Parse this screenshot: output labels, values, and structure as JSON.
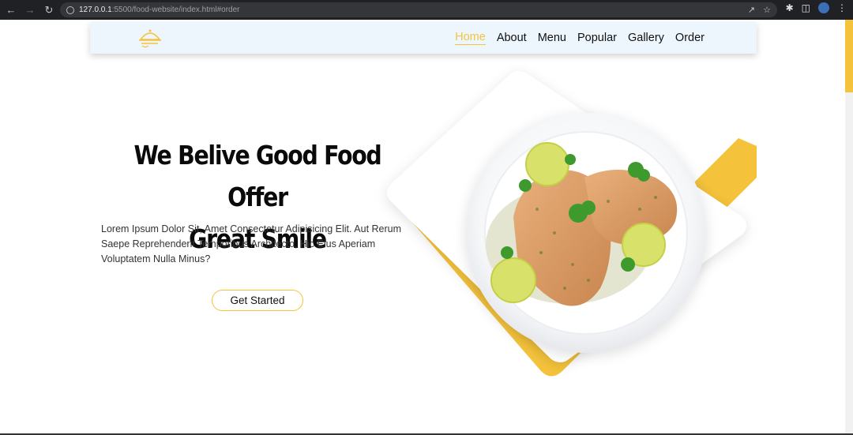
{
  "browser": {
    "url_host": "127.0.0.1",
    "url_rest": ":5500/food-website/index.html#order"
  },
  "header": {
    "nav": [
      {
        "label": "Home",
        "active": true
      },
      {
        "label": "About"
      },
      {
        "label": "Menu"
      },
      {
        "label": "Popular"
      },
      {
        "label": "Gallery"
      },
      {
        "label": "Order"
      }
    ]
  },
  "hero": {
    "headline_line1": "We Belive Good Food Offer",
    "headline_line2": "Great Smile",
    "description": "Lorem Ipsum Dolor Sit, Amet Consectetur Adipisicing Elit. Aut Rerum Saepe Reprehenderit Temporibus Architecto, Hic Eius Aperiam Voluptatem Nulla Minus?",
    "cta_label": "Get Started"
  },
  "colors": {
    "accent": "#f5c33b",
    "header_bg": "#eef6fd"
  },
  "icons": [
    "back-arrow-icon",
    "forward-arrow-icon",
    "reload-icon",
    "info-icon",
    "share-icon",
    "star-icon",
    "extensions-icon",
    "sidepanel-icon",
    "menu-dots-icon",
    "logo-icon"
  ]
}
